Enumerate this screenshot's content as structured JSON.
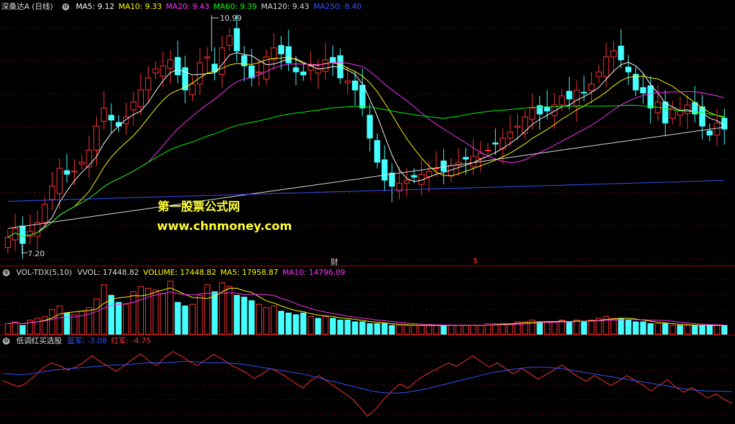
{
  "price_panel": {
    "title": "深桑达A (日线)",
    "ma_labels": [
      {
        "text": "MA5: 9.12",
        "color": "#ffffff"
      },
      {
        "text": "MA10: 9.33",
        "color": "#ffff00"
      },
      {
        "text": "MA20: 9.43",
        "color": "#ff33ff"
      },
      {
        "text": "MA60: 9.39",
        "color": "#00ff00"
      },
      {
        "text": "MA120: 9.43",
        "color": "#dddddd"
      },
      {
        "text": "MA250: 8.40",
        "color": "#3355ff"
      }
    ],
    "high_label": "10.99",
    "low_label": "7.20",
    "marker_cai": "财",
    "marker_dollar": "$",
    "watermark_line1": "第一股票公式网",
    "watermark_line2": "www.chnmoney.com"
  },
  "volume_panel": {
    "title": "VOL-TDX(5,10)",
    "labels": [
      {
        "text": "VVOL: 17448.82",
        "color": "#dddddd"
      },
      {
        "text": "VOLUME: 17448.82",
        "color": "#ffff00"
      },
      {
        "text": "MA5: 17958.87",
        "color": "#ffff00"
      },
      {
        "text": "MA10: 14796.09",
        "color": "#ff33ff"
      }
    ]
  },
  "indicator_panel": {
    "title": "低调红买选股",
    "labels": [
      {
        "text": "蓝军: -3.08",
        "color": "#3355ff"
      },
      {
        "text": "红军: -4.75",
        "color": "#ff3333"
      }
    ]
  },
  "colors": {
    "up": "#ff3333",
    "down": "#44ffff",
    "grid": "#880000",
    "bg": "#000000"
  },
  "chart_data": [
    {
      "type": "candlestick",
      "ylim": [
        7.0,
        11.2
      ],
      "closes": [
        7.45,
        7.6,
        7.35,
        7.55,
        7.7,
        8.0,
        8.3,
        8.6,
        8.5,
        8.55,
        8.7,
        8.9,
        9.3,
        9.6,
        9.4,
        9.3,
        9.45,
        9.7,
        9.9,
        10.1,
        10.25,
        10.3,
        10.4,
        10.15,
        9.9,
        10.0,
        10.35,
        10.45,
        10.2,
        10.6,
        10.8,
        10.55,
        10.3,
        10.1,
        10.2,
        10.45,
        10.6,
        10.5,
        10.35,
        10.2,
        10.15,
        10.3,
        10.25,
        10.4,
        10.35,
        10.1,
        10.05,
        9.9,
        9.6,
        9.1,
        8.7,
        8.4,
        8.3,
        8.35,
        8.4,
        8.45,
        8.5,
        8.55,
        8.6,
        8.55,
        8.65,
        8.7,
        8.75,
        8.8,
        8.85,
        8.9,
        9.0,
        9.1,
        9.2,
        9.3,
        9.45,
        9.6,
        9.5,
        9.55,
        9.65,
        9.8,
        9.75,
        9.9,
        9.85,
        10.0,
        10.2,
        10.45,
        10.55,
        10.4,
        10.2,
        9.9,
        9.85,
        9.6,
        9.7,
        9.35,
        9.6,
        9.55,
        9.65,
        9.5,
        9.3,
        9.15,
        9.35,
        9.25
      ]
    },
    {
      "type": "bar",
      "title": "VOL-TDX(5,10)",
      "values": [
        6,
        7,
        5,
        8,
        9,
        10,
        14,
        16,
        12,
        11,
        13,
        15,
        20,
        28,
        22,
        18,
        17,
        24,
        27,
        26,
        25,
        23,
        30,
        18,
        16,
        17,
        22,
        28,
        24,
        29,
        27,
        22,
        21,
        19,
        17,
        15,
        16,
        13,
        12,
        11,
        12,
        10,
        9,
        10,
        9,
        8,
        8,
        7,
        7,
        6,
        6,
        6,
        5,
        5,
        5,
        5,
        5,
        5,
        5,
        5,
        5,
        5,
        5,
        5,
        5,
        6,
        6,
        6,
        6,
        7,
        7,
        8,
        7,
        7,
        7,
        8,
        7,
        8,
        7,
        8,
        9,
        10,
        9,
        9,
        8,
        7,
        7,
        6,
        6,
        6,
        5,
        5,
        5,
        5,
        5,
        5,
        5,
        5
      ]
    },
    {
      "type": "line",
      "title": "低调红买选股",
      "series": [
        {
          "name": "红军",
          "values": [
            -1.5,
            -2.0,
            -2.4,
            -1.8,
            -0.8,
            0.3,
            1.0,
            0.6,
            0.0,
            0.4,
            1.1,
            2.0,
            1.2,
            0.5,
            -0.2,
            0.6,
            1.5,
            2.3,
            1.3,
            0.6,
            1.8,
            2.6,
            2.0,
            1.2,
            0.6,
            1.4,
            2.2,
            1.6,
            0.8,
            0.2,
            -0.4,
            -1.2,
            -0.6,
            0.2,
            -0.3,
            -1.0,
            -1.8,
            -2.6,
            -1.5,
            -0.8,
            -1.6,
            -2.4,
            -3.2,
            -4.0,
            -5.2,
            -6.6,
            -5.6,
            -4.2,
            -3.0,
            -2.0,
            -2.6,
            -1.6,
            -0.8,
            -0.2,
            0.4,
            1.0,
            0.5,
            1.3,
            2.0,
            1.2,
            0.4,
            1.0,
            0.2,
            -0.6,
            0.2,
            -0.5,
            -1.3,
            -0.7,
            0.0,
            0.7,
            -0.2,
            -1.0,
            -1.6,
            -0.8,
            -1.5,
            -2.2,
            -1.6,
            -0.8,
            -1.5,
            -2.2,
            -3.0,
            -2.2,
            -1.4,
            -2.4,
            -3.2,
            -2.5,
            -3.3,
            -4.0,
            -3.4,
            -4.2,
            -4.75
          ]
        },
        {
          "name": "蓝军",
          "values": [
            -0.5,
            -0.6,
            -0.7,
            -0.6,
            -0.4,
            -0.2,
            0.0,
            0.1,
            0.2,
            0.3,
            0.4,
            0.5,
            0.6,
            0.7,
            0.7,
            0.8,
            0.9,
            1.0,
            1.0,
            1.0,
            1.1,
            1.2,
            1.2,
            1.1,
            1.0,
            1.0,
            1.0,
            0.9,
            0.8,
            0.6,
            0.4,
            0.2,
            0.0,
            -0.2,
            -0.4,
            -0.6,
            -0.9,
            -1.2,
            -1.5,
            -1.8,
            -2.1,
            -2.4,
            -2.7,
            -3.0,
            -3.2,
            -3.3,
            -3.3,
            -3.2,
            -3.0,
            -2.8,
            -2.5,
            -2.2,
            -1.9,
            -1.6,
            -1.3,
            -1.0,
            -0.7,
            -0.4,
            -0.2,
            0.0,
            0.2,
            0.3,
            0.4,
            0.4,
            0.3,
            0.2,
            0.0,
            -0.2,
            -0.4,
            -0.6,
            -0.8,
            -1.0,
            -1.2,
            -1.4,
            -1.6,
            -1.8,
            -2.0,
            -2.2,
            -2.4,
            -2.6,
            -2.8,
            -2.9,
            -3.0,
            -3.0,
            -3.05,
            -3.08
          ]
        }
      ]
    }
  ]
}
